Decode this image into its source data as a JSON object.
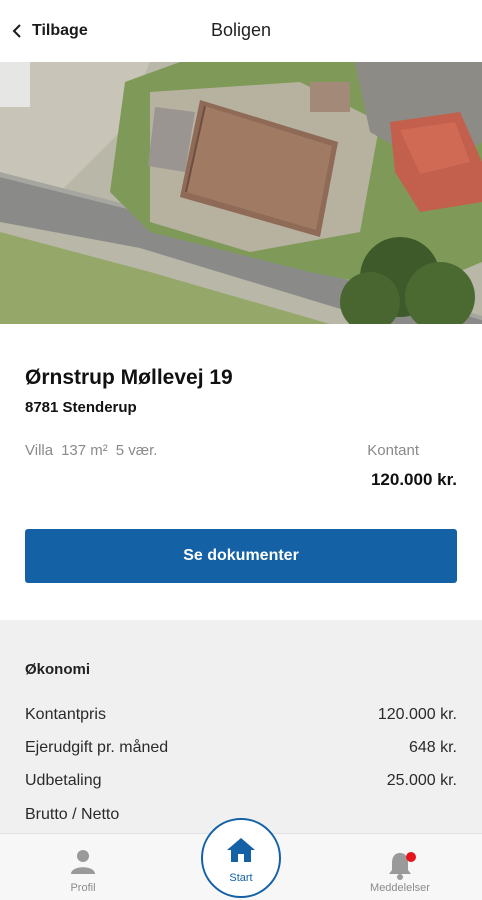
{
  "header": {
    "back_label": "Tilbage",
    "title": "Boligen"
  },
  "property": {
    "address": "Ørnstrup Møllevej 19",
    "city": "8781 Stenderup",
    "type": "Villa",
    "area": "137 m²",
    "rooms": "5 vær.",
    "price_label": "Kontant",
    "price_value": "120.000 kr."
  },
  "documents_button": "Se dokumenter",
  "economy": {
    "title": "Økonomi",
    "rows": [
      {
        "label": "Kontantpris",
        "value": "120.000 kr."
      },
      {
        "label": "Ejerudgift pr. måned",
        "value": "648 kr."
      },
      {
        "label": "Udbetaling",
        "value": "25.000 kr."
      },
      {
        "label": "Brutto / Netto",
        "value": ""
      }
    ]
  },
  "nav": {
    "profile": "Profil",
    "start": "Start",
    "messages": "Meddelelser"
  },
  "colors": {
    "accent": "#1461a6",
    "notification": "#e5151d"
  }
}
